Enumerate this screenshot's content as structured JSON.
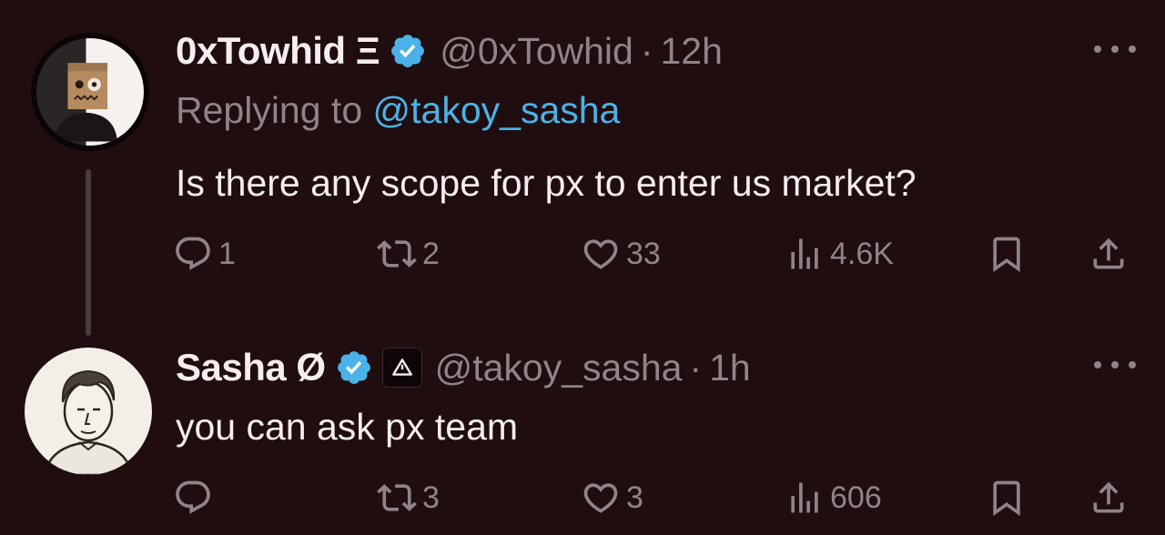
{
  "tweets": [
    {
      "author_name": "0xTowhid Ξ",
      "handle": "@0xTowhid",
      "time": "12h",
      "replying_label": "Replying to",
      "replying_handle": "@takoy_sasha",
      "text": "Is there any scope for px to enter us market?",
      "reply_count": "1",
      "retweet_count": "2",
      "like_count": "33",
      "view_count": "4.6K"
    },
    {
      "author_name": "Sasha Ø",
      "handle": "@takoy_sasha",
      "time": "1h",
      "text": "you can ask px team",
      "reply_count": "",
      "retweet_count": "3",
      "like_count": "3",
      "view_count": "606"
    }
  ],
  "colors": {
    "background": "#1f0d0f",
    "muted": "#8f8487",
    "link": "#4ab2e8",
    "verified": "#4ab2e8"
  },
  "icons": [
    "verified-badge-icon",
    "affiliate-badge-icon",
    "more-icon",
    "reply-icon",
    "retweet-icon",
    "like-icon",
    "views-icon",
    "bookmark-icon",
    "share-icon"
  ]
}
